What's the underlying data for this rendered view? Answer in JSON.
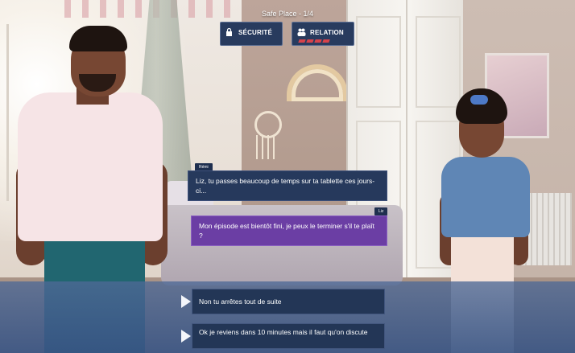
{
  "hud": {
    "episode_label": "Safe Place - 1/4",
    "security_label": "SÉCURITÉ",
    "relation_label": "RELATION",
    "security_icon": "lock-icon",
    "relation_icon": "people-icon",
    "relation_meter_color": "#d6424b"
  },
  "dialogue": [
    {
      "speaker": "Rémi",
      "text": "Liz, tu passes beaucoup de temps sur ta tablette ces jours-ci...",
      "color": "#26395c"
    },
    {
      "speaker": "Liz",
      "text": "Mon épisode est bientôt fini, je peux le terminer s'il te plaît ?",
      "color": "#6b3ea4"
    }
  ],
  "choices": [
    {
      "text": "Non tu arrêtes tout de suite"
    },
    {
      "text": "Ok je reviens dans 10 minutes mais il faut qu'on discute"
    }
  ],
  "colors": {
    "panel": "#233656",
    "choice_band": "#4e6996",
    "arrow": "#f4f6fa"
  }
}
